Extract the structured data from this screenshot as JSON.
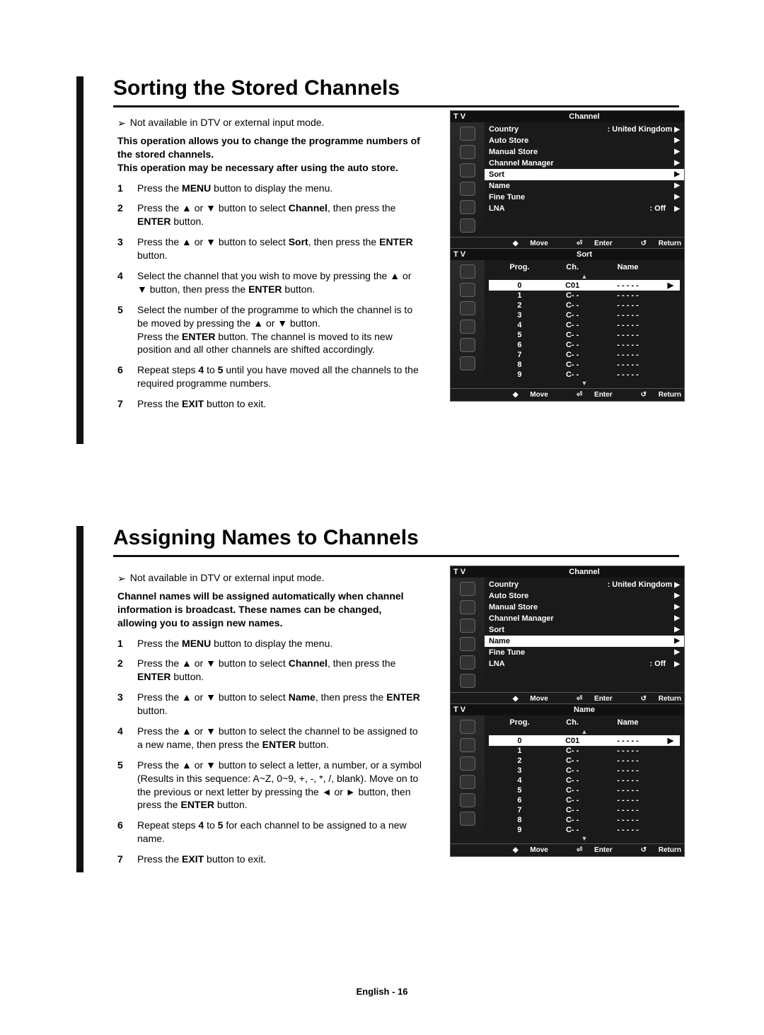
{
  "section1": {
    "title": "Sorting the Stored Channels",
    "note": "Not available in DTV or external input mode.",
    "intro": "This operation allows you to change the programme numbers of the stored channels.\nThis operation may be necessary after using the auto store.",
    "steps": [
      "Press the <b>MENU</b> button to display the menu.",
      "Press the ▲ or ▼ button to select <b>Channel</b>, then press the <b>ENTER</b> button.",
      "Press the ▲ or ▼ button to select <b>Sort</b>, then press the <b>ENTER</b> button.",
      "Select the channel that you wish to move by pressing the ▲ or ▼ button, then press the <b>ENTER</b> button.",
      "Select the number of the programme to which the channel is to be moved by pressing the ▲ or ▼ button.\nPress the <b>ENTER</b> button. The channel is moved to its new position and all other channels are shifted accordingly.",
      "Repeat steps <b>4</b> to <b>5</b> until you have moved all the channels to the required programme numbers.",
      "Press the <b>EXIT</b> button to exit."
    ]
  },
  "section2": {
    "title": "Assigning Names to Channels",
    "note": "Not available in DTV or external input mode.",
    "intro": "Channel names will be assigned automatically when channel information is broadcast. These names can be changed, allowing you to assign new names.",
    "steps": [
      "Press the <b>MENU</b> button to display the menu.",
      "Press the ▲ or ▼ button to select <b>Channel</b>, then press the <b>ENTER</b> button.",
      "Press the ▲ or ▼ button to select <b>Name</b>, then press the <b>ENTER</b> button.",
      "Press the ▲ or ▼ button to select the channel to be assigned to a new name, then press the <b>ENTER</b> button.",
      "Press the ▲ or ▼ button to select a letter, a number, or a symbol (Results in this sequence: A~Z, 0~9, +, -, *, /, blank). Move on to the previous or next letter by pressing the ◄ or ► button, then press the <b>ENTER</b> button.",
      "Repeat steps <b>4</b> to <b>5</b> for each channel to be assigned to a new name.",
      "Press the <b>EXIT</b> button to exit."
    ]
  },
  "osd_common": {
    "tv_label": "T V",
    "country_label": "Country",
    "country_value": ": United Kingdom",
    "auto_store": "Auto Store",
    "manual_store": "Manual Store",
    "channel_manager": "Channel Manager",
    "sort": "Sort",
    "name": "Name",
    "fine_tune": "Fine Tune",
    "lna": "LNA",
    "off": ": Off",
    "move": "Move",
    "enter": "Enter",
    "return": "Return",
    "channel_title": "Channel",
    "sort_title": "Sort",
    "name_title": "Name",
    "col_prog": "Prog.",
    "col_ch": "Ch.",
    "col_name": "Name",
    "arrow_tri": "▶",
    "up_arrow": "▲",
    "down_arrow": "▼",
    "move_dia": "◆"
  },
  "sort_table": [
    {
      "prog": "0",
      "ch": "C01",
      "name": "- - - - -",
      "sel": true
    },
    {
      "prog": "1",
      "ch": "C- -",
      "name": "- - - - -"
    },
    {
      "prog": "2",
      "ch": "C- -",
      "name": "- - - - -"
    },
    {
      "prog": "3",
      "ch": "C- -",
      "name": "- - - - -"
    },
    {
      "prog": "4",
      "ch": "C- -",
      "name": "- - - - -"
    },
    {
      "prog": "5",
      "ch": "C- -",
      "name": "- - - - -"
    },
    {
      "prog": "6",
      "ch": "C- -",
      "name": "- - - - -"
    },
    {
      "prog": "7",
      "ch": "C- -",
      "name": "- - - - -"
    },
    {
      "prog": "8",
      "ch": "C- -",
      "name": "- - - - -"
    },
    {
      "prog": "9",
      "ch": "C- -",
      "name": "- - - - -"
    }
  ],
  "footer": "English - 16"
}
